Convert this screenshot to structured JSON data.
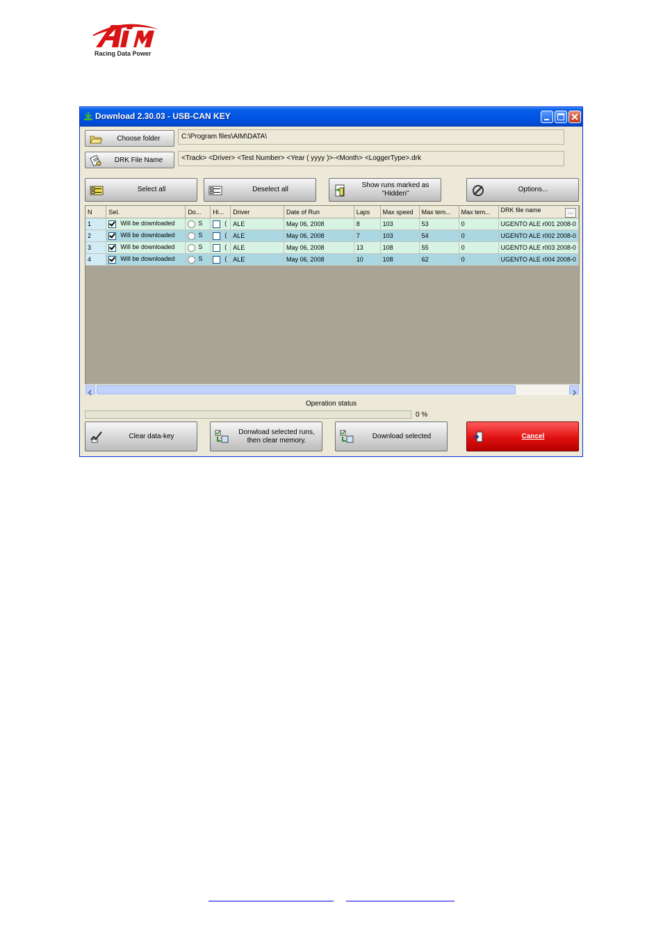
{
  "logo": {
    "brand": "AiM",
    "tagline": "Racing Data Power"
  },
  "window": {
    "title": "Download 2.30.03 - USB-CAN KEY",
    "choose_folder_label": "Choose folder",
    "folder_path": "C:\\Program files\\AIM\\DATA\\",
    "drk_button_label": "DRK File Name",
    "drk_pattern": "<Track> <Driver> <Test Number> <Year ( yyyy )>-<Month> <LoggerType>.drk",
    "select_all_label": "Select all",
    "deselect_all_label": "Deselect all",
    "show_hidden_label": "Show runs marked as \"Hidden\"",
    "options_label": "Options...",
    "operation_status_label": "Operation status",
    "progress_percent": 0,
    "progress_text": "0 %",
    "clear_key_label": "Clear data-key",
    "download_clear_label": "Donwload selected runs, then clear memory.",
    "download_selected_label": "Download selected",
    "cancel_label": "Cancel"
  },
  "table": {
    "columns": [
      "N",
      "Sel.",
      "Do...",
      "Hi...",
      "Driver",
      "Date of Run",
      "Laps",
      "Max speed",
      "Max tem...",
      "Max tem...",
      "DRK file name"
    ],
    "more_label": "...",
    "rows": [
      {
        "n": "1",
        "sel": "Will be downloaded",
        "do": "S",
        "hi": "(",
        "driver": "ALE",
        "date": "May  06,  2008",
        "laps": "8",
        "max_speed": "103",
        "max_temp1": "53",
        "max_temp2": "0",
        "file": "UGENTO ALE r001 2008-0"
      },
      {
        "n": "2",
        "sel": "Will be downloaded",
        "do": "S",
        "hi": "(",
        "driver": "ALE",
        "date": "May  06,  2008",
        "laps": "7",
        "max_speed": "103",
        "max_temp1": "54",
        "max_temp2": "0",
        "file": "UGENTO ALE r002 2008-0"
      },
      {
        "n": "3",
        "sel": "Will be downloaded",
        "do": "S",
        "hi": "(",
        "driver": "ALE",
        "date": "May  06,  2008",
        "laps": "13",
        "max_speed": "108",
        "max_temp1": "55",
        "max_temp2": "0",
        "file": "UGENTO ALE r003 2008-0"
      },
      {
        "n": "4",
        "sel": "Will be downloaded",
        "do": "S",
        "hi": "(",
        "driver": "ALE",
        "date": "May  06,  2008",
        "laps": "10",
        "max_speed": "108",
        "max_temp1": "62",
        "max_temp2": "0",
        "file": "UGENTO ALE r004 2008-0"
      }
    ]
  },
  "colors": {
    "titlebar": "#0055e5",
    "cancel": "#e01010",
    "row_even": "#d7f3e4",
    "row_odd": "#abd7e3",
    "grid_bg": "#a8a496"
  }
}
